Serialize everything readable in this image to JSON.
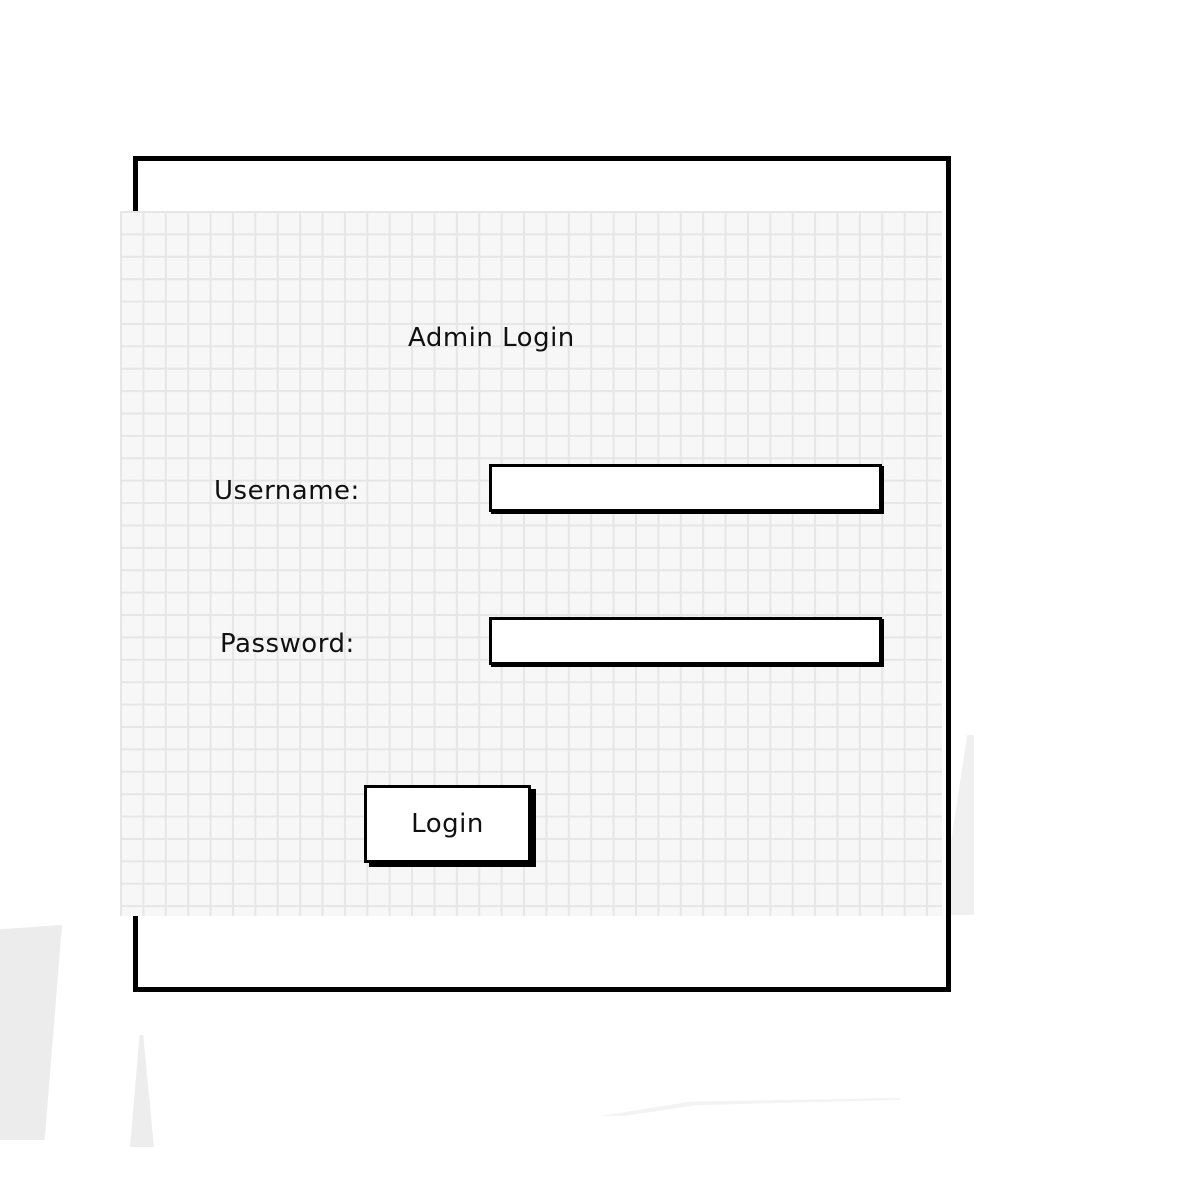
{
  "login_form": {
    "title": "Admin Login",
    "username": {
      "label": "Username:",
      "value": "",
      "placeholder": ""
    },
    "password": {
      "label": "Password:",
      "value": "",
      "placeholder": ""
    },
    "submit_label": "Login"
  },
  "colors": {
    "frame_border": "#000000",
    "grid_background": "#f7f7f7",
    "grid_lines": "#e6e6e6"
  }
}
